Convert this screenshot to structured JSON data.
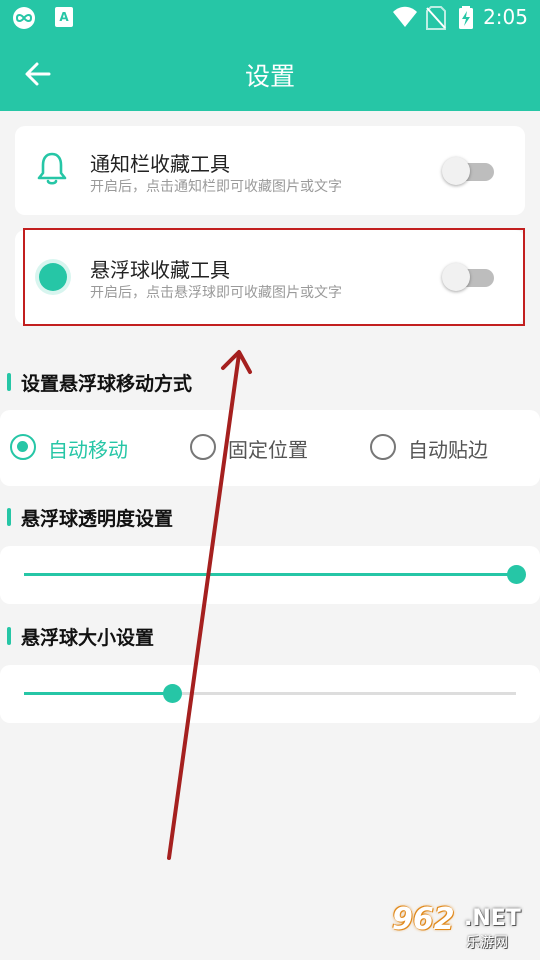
{
  "status_bar": {
    "time": "2:05",
    "icons": [
      "infinity-app-icon",
      "accessibility-a-icon",
      "wifi-icon",
      "no-sim-icon",
      "battery-charging-icon"
    ]
  },
  "app_bar": {
    "title": "设置",
    "back_icon": "arrow-left-icon"
  },
  "colors": {
    "accent": "#26c6a6",
    "highlight_box": "#c21f1f",
    "annotation_arrow": "#a5201f"
  },
  "tools": [
    {
      "title": "通知栏收藏工具",
      "subtitle": "开启后，点击通知栏即可收藏图片或文字",
      "icon": "bell-icon",
      "enabled": false
    },
    {
      "title": "悬浮球收藏工具",
      "subtitle": "开启后，点击悬浮球即可收藏图片或文字",
      "icon": "floating-ball-icon",
      "enabled": false
    }
  ],
  "move_mode": {
    "title": "设置悬浮球移动方式",
    "options": [
      "自动移动",
      "固定位置",
      "自动贴边"
    ],
    "selected": "自动移动"
  },
  "opacity": {
    "title": "悬浮球透明度设置",
    "value_fraction": 1.0
  },
  "size": {
    "title": "悬浮球大小设置",
    "value_fraction": 0.3
  },
  "watermark": {
    "number": "962",
    "domain": ".NET",
    "name": "乐游网"
  }
}
